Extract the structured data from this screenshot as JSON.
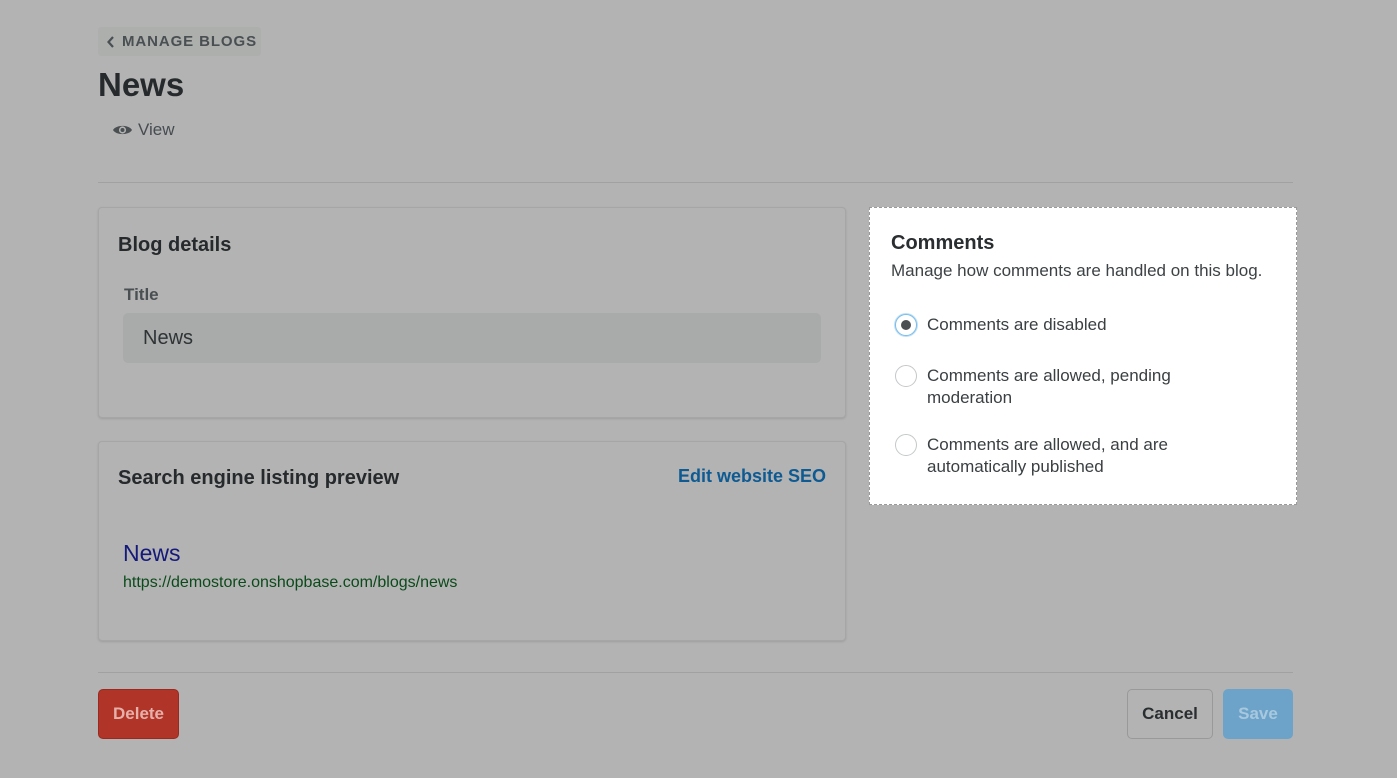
{
  "header": {
    "back_label": "MANAGE BLOGS",
    "back_icon": "chevron-left-icon",
    "title": "News",
    "view_label": "View",
    "view_icon": "eye-icon"
  },
  "blog_details": {
    "heading": "Blog details",
    "title_label": "Title",
    "title_value": "News"
  },
  "seo_preview": {
    "heading": "Search engine listing preview",
    "edit_link": "Edit website SEO",
    "preview_title": "News",
    "preview_url": "https://demostore.onshopbase.com/blogs/news"
  },
  "comments": {
    "heading": "Comments",
    "description": "Manage how comments are handled on this blog.",
    "options": [
      {
        "label": "Comments are disabled",
        "checked": true
      },
      {
        "label": "Comments are allowed, pending moderation",
        "checked": false
      },
      {
        "label": "Comments are allowed, and are automatically published",
        "checked": false
      }
    ]
  },
  "footer": {
    "delete_label": "Delete",
    "cancel_label": "Cancel",
    "save_label": "Save"
  },
  "colors": {
    "overlay": "#b3b3b3",
    "delete": "#b03427",
    "save": "#6da3c8",
    "link": "#0e5a92"
  }
}
